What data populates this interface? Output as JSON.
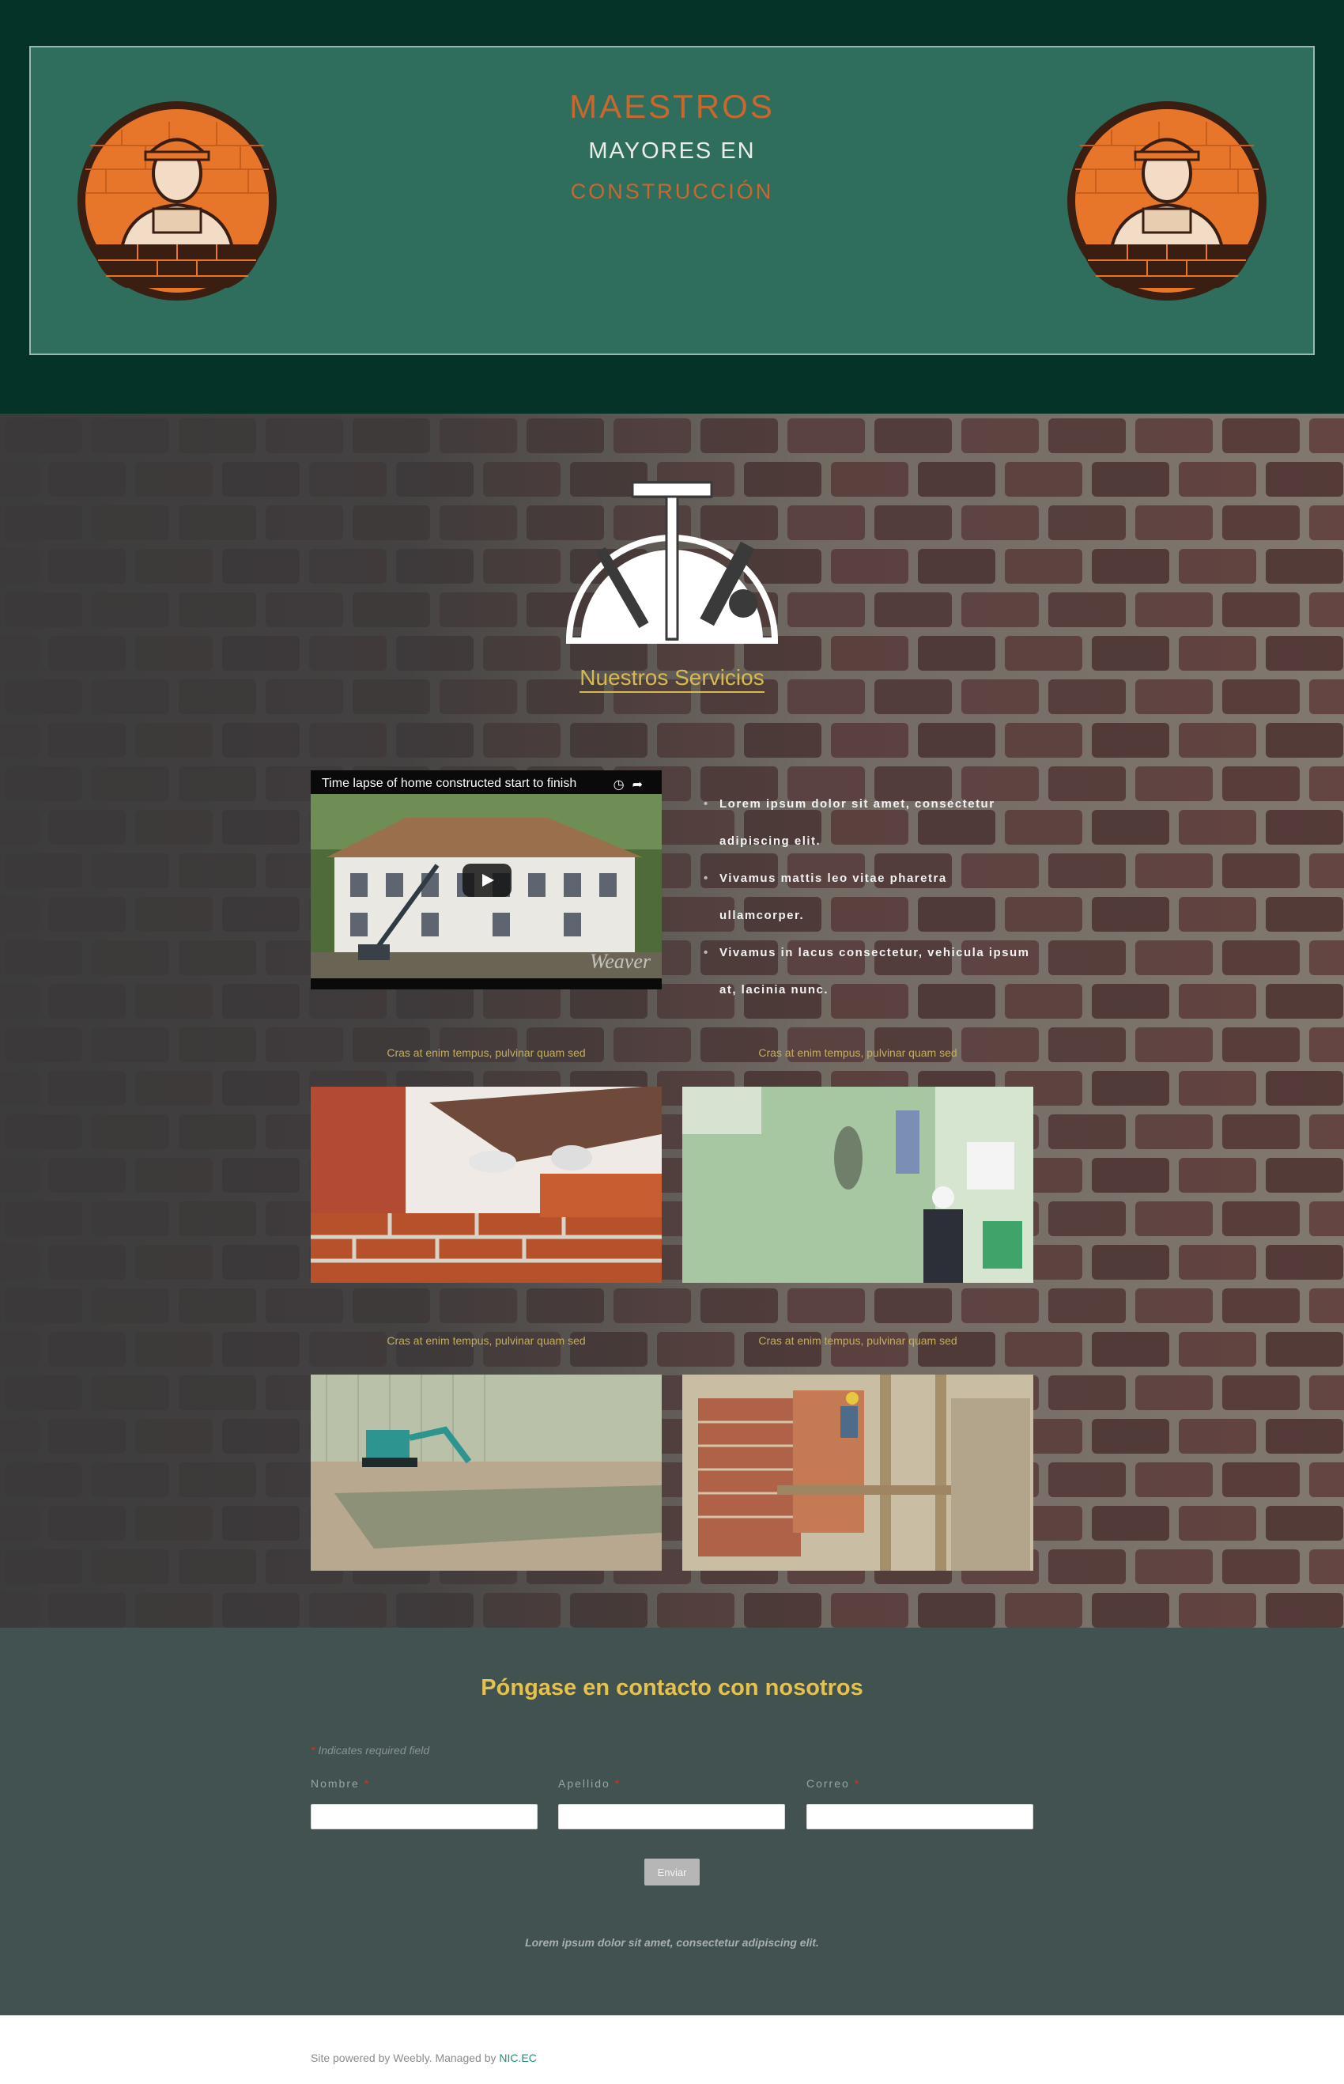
{
  "header": {
    "title_line1": "MAESTROS",
    "title_line2": "MAYORES EN",
    "title_line3": "CONSTRUCCIÓN",
    "logo_icon": "bricklayer-logo-icon"
  },
  "services": {
    "title": "Nuestros Servicios",
    "emblem_icon": "tools-emblem-icon",
    "video": {
      "title": "Time lapse of home constructed start to finish",
      "watermark": "Weaver"
    },
    "bullets": [
      "Lorem ipsum dolor sit amet, consectetur adipiscing elit.",
      "Vivamus mattis leo vitae pharetra ullamcorper.",
      "Vivamus in lacus consectetur, vehicula ipsum at, lacinia nunc."
    ],
    "gallery": [
      {
        "caption": "Cras at enim tempus, pulvinar quam sed"
      },
      {
        "caption": "Cras at enim tempus, pulvinar quam sed"
      },
      {
        "caption": "Cras at enim tempus, pulvinar quam sed"
      },
      {
        "caption": "Cras at enim tempus, pulvinar quam sed"
      }
    ]
  },
  "contact": {
    "title": "Póngase en contacto con nosotros",
    "required_note": "Indicates required field",
    "fields": [
      {
        "label": "Nombre",
        "value": ""
      },
      {
        "label": "Apellido",
        "value": ""
      },
      {
        "label": "Correo",
        "value": ""
      }
    ],
    "submit_label": "Enviar",
    "footer_text": "Lorem ipsum dolor sit amet, consectetur adipiscing elit."
  },
  "footer": {
    "text": "Site powered by Weebly. Managed by",
    "link": "NIC.EC"
  },
  "colors": {
    "header_bg": "#063327",
    "header_panel": "#2f6e5d",
    "accent_orange": "#c8682e",
    "accent_gold": "#d8b94c",
    "contact_bg": "#425251"
  }
}
